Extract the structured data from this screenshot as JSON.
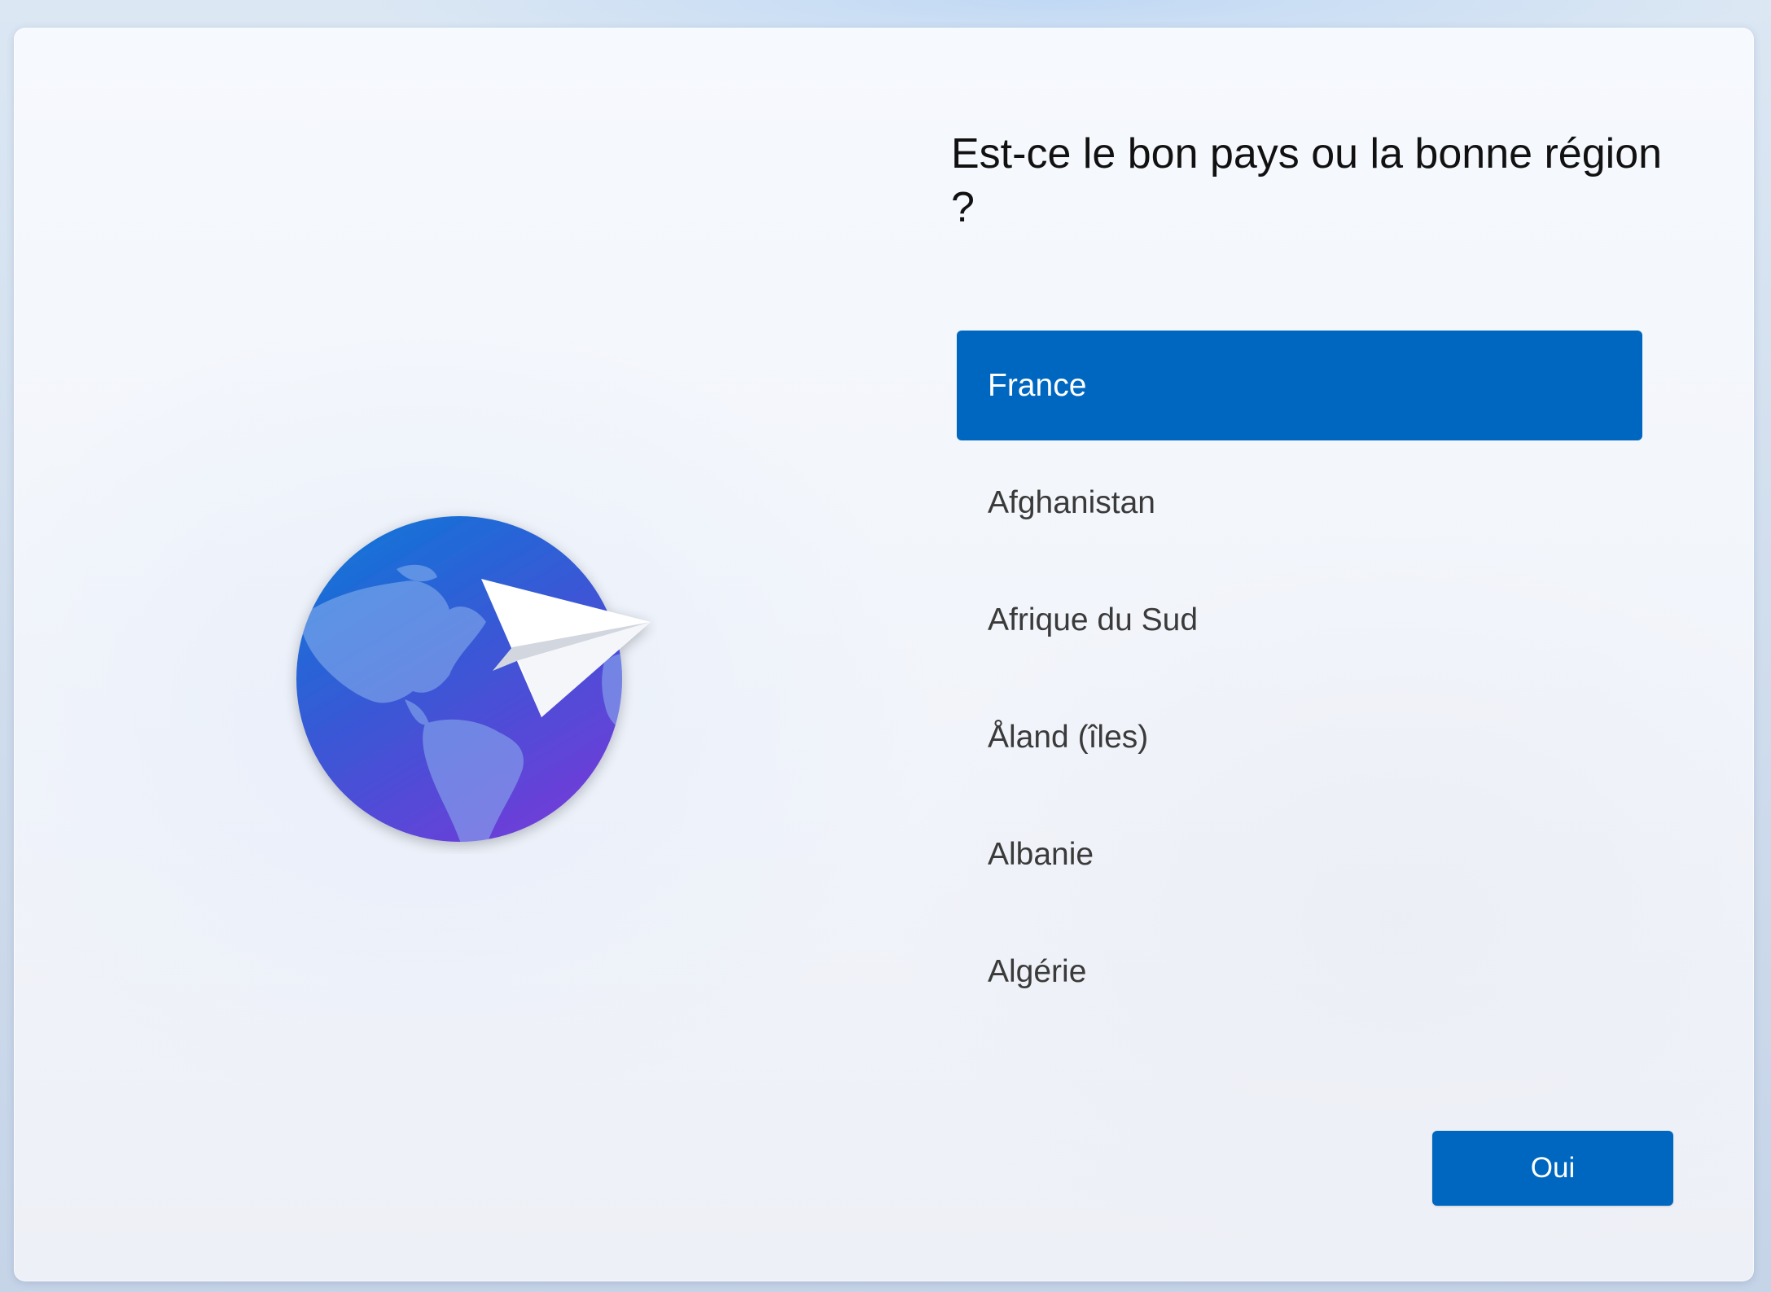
{
  "dialog": {
    "title": "Est-ce le bon pays ou la bonne région ?",
    "illustration_icon": "globe-paper-plane-icon"
  },
  "countries": {
    "selected_index": 0,
    "items": [
      {
        "label": "France",
        "selected": true
      },
      {
        "label": "Afghanistan",
        "selected": false
      },
      {
        "label": "Afrique du Sud",
        "selected": false
      },
      {
        "label": "Åland (îles)",
        "selected": false
      },
      {
        "label": "Albanie",
        "selected": false
      },
      {
        "label": "Algérie",
        "selected": false
      }
    ]
  },
  "actions": {
    "confirm_label": "Oui"
  },
  "colors": {
    "accent": "#0067c0",
    "selected_text": "#ffffff",
    "item_text": "#3a3a3a",
    "title_text": "#111111"
  }
}
